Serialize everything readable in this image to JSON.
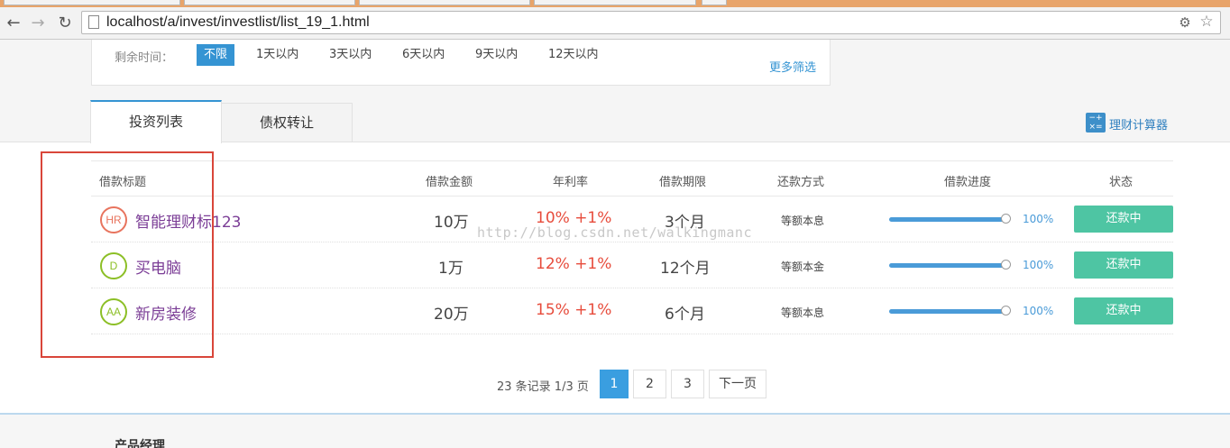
{
  "browser": {
    "url": "localhost/a/invest/investlist/list_19_1.html",
    "icons": [
      "back-icon",
      "forward-icon",
      "reload-icon",
      "page-icon",
      "tools-icon",
      "star-icon"
    ]
  },
  "filter": {
    "label": "剩余时间：",
    "options": [
      "不限",
      "1天以内",
      "3天以内",
      "6天以内",
      "9天以内",
      "12天以内"
    ],
    "active_index": 0,
    "more": "更多筛选"
  },
  "tabs": {
    "invest": "投资列表",
    "debt": "债权转让",
    "calculator": "理财计算器"
  },
  "table": {
    "headers": [
      "借款标题",
      "借款金额",
      "年利率",
      "借款期限",
      "还款方式",
      "借款进度",
      "状态"
    ],
    "rows": [
      {
        "badge": "HR",
        "badge_color": "#e8745e",
        "title": "智能理财标123",
        "amount": "10万",
        "rate": "10% +1%",
        "term": "3个月",
        "method": "等额本息",
        "progress_value": 100,
        "progress": "100%",
        "status": "还款中"
      },
      {
        "badge": "D",
        "badge_color": "#8cbf26",
        "title": "买电脑",
        "amount": "1万",
        "rate": "12% +1%",
        "term": "12个月",
        "method": "等额本金",
        "progress_value": 100,
        "progress": "100%",
        "status": "还款中"
      },
      {
        "badge": "AA",
        "badge_color": "#8cbf26",
        "title": "新房装修",
        "amount": "20万",
        "rate": "15% +1%",
        "term": "6个月",
        "method": "等额本息",
        "progress_value": 100,
        "progress": "100%",
        "status": "还款中"
      }
    ]
  },
  "watermark": "http://blog.csdn.net/walkingmanc",
  "pagination": {
    "info": "23 条记录 1/3 页",
    "pages": [
      "1",
      "2",
      "3"
    ],
    "active_page": "1",
    "next": "下一页"
  },
  "footer": {
    "product_manager": "产品经理"
  },
  "colors": {
    "accent": "#3594d3",
    "title": "#7b3d96",
    "rate": "#e74c3c",
    "status_button": "#4ec5a3",
    "highlight_box": "#d9463a"
  }
}
